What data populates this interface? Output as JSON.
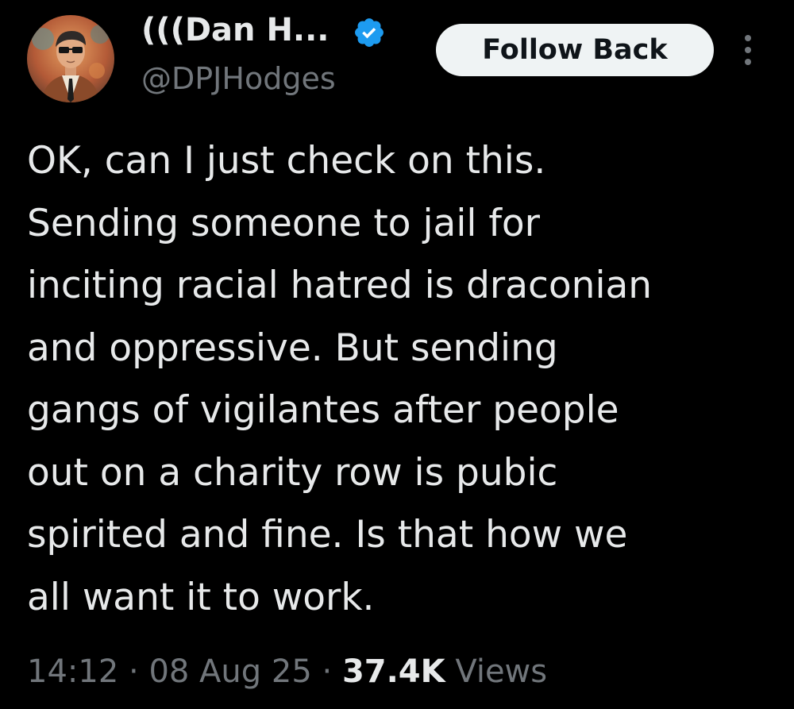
{
  "author": {
    "display_name": "(((Dan H...",
    "handle": "@DPJHodges",
    "verified": true,
    "avatar": "portrait-avatar"
  },
  "actions": {
    "follow_label": "Follow Back",
    "more_icon": "vertical-ellipsis-icon"
  },
  "tweet": {
    "lines": [
      "OK, can I just check on this.",
      "Sending someone to jail for",
      "inciting racial hatred is draconian",
      "and oppressive. But sending",
      "gangs of vigilantes after people",
      "out on a charity row is pubic",
      "spirited and fine. Is that how we",
      "all want it to work."
    ]
  },
  "meta": {
    "time": "14:12",
    "separator": " · ",
    "date": "08 Aug 25",
    "views_count": "37.4K",
    "views_label": "Views"
  },
  "colors": {
    "background": "#000000",
    "text": "#e7e9ea",
    "secondary": "#71767b",
    "verified": "#1d9bf0",
    "follow_bg": "#eff3f4"
  }
}
